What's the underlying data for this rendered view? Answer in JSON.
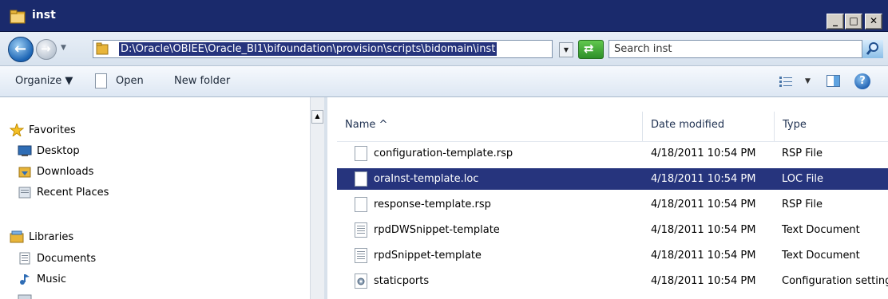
{
  "window": {
    "title": "inst",
    "minimize": "_",
    "maximize": "□",
    "close": "✕"
  },
  "address": {
    "path": "D:\\Oracle\\OBIEE\\Oracle_BI1\\bifoundation\\provision\\scripts\\bidomain\\inst",
    "search_placeholder": "Search inst"
  },
  "toolbar": {
    "organize": "Organize ▼",
    "open": "Open",
    "new_folder": "New folder"
  },
  "nav": {
    "favorites": "Favorites",
    "desktop": "Desktop",
    "downloads": "Downloads",
    "recent": "Recent Places",
    "libraries": "Libraries",
    "documents": "Documents",
    "music": "Music"
  },
  "columns": {
    "name": "Name ^",
    "date": "Date modified",
    "type": "Type"
  },
  "files": [
    {
      "name": "configuration-template.rsp",
      "date": "4/18/2011 10:54 PM",
      "type": "RSP File"
    },
    {
      "name": "oraInst-template.loc",
      "date": "4/18/2011 10:54 PM",
      "type": "LOC File"
    },
    {
      "name": "response-template.rsp",
      "date": "4/18/2011 10:54 PM",
      "type": "RSP File"
    },
    {
      "name": "rpdDWSnippet-template",
      "date": "4/18/2011 10:54 PM",
      "type": "Text Document"
    },
    {
      "name": "rpdSnippet-template",
      "date": "4/18/2011 10:54 PM",
      "type": "Text Document"
    },
    {
      "name": "staticports",
      "date": "4/18/2011 10:54 PM",
      "type": "Configuration setting"
    }
  ],
  "selected_file": "oraInst-template.loc",
  "colors": {
    "title_bar": "#1a2a6c",
    "selection": "#26347d"
  },
  "icons": {
    "title": "folder-icon",
    "back": "back-arrow-icon",
    "forward": "forward-arrow-icon",
    "refresh": "refresh-icon",
    "search": "magnifier-icon",
    "help": "help-icon",
    "view": "view-options-icon",
    "preview": "preview-pane-icon"
  }
}
